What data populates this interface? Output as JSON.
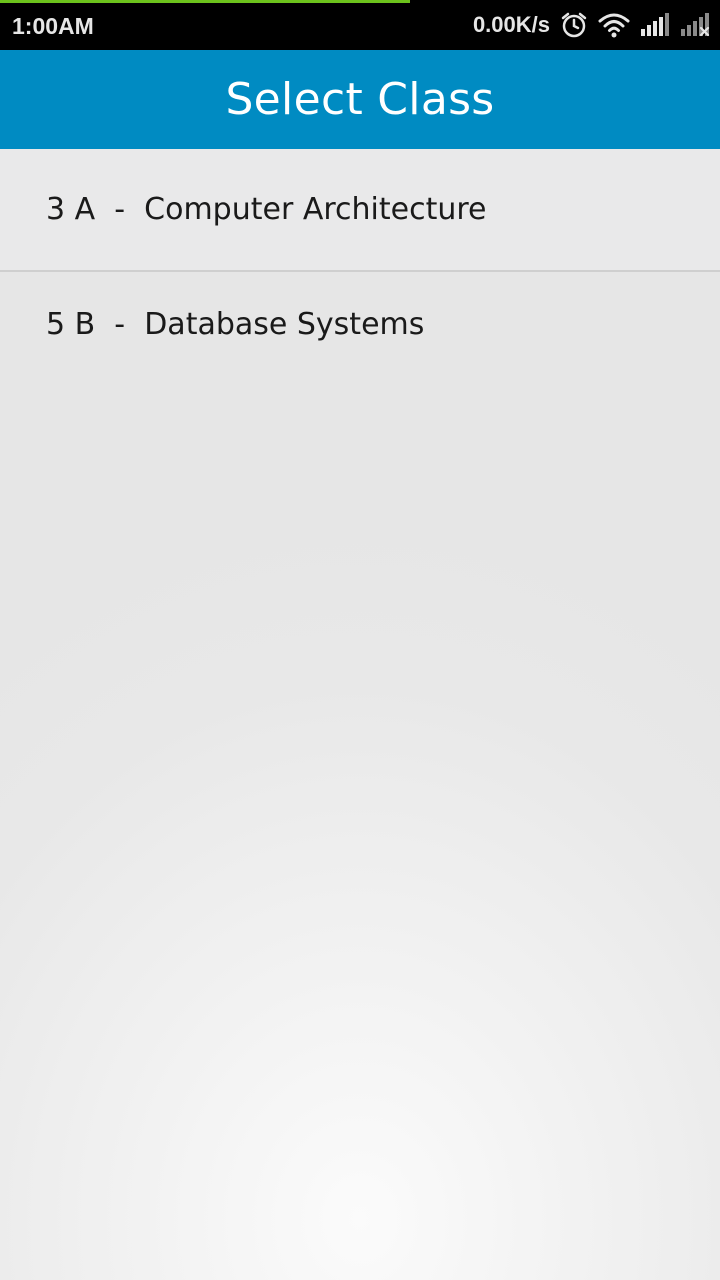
{
  "status_bar": {
    "time": "1:00AM",
    "net_speed": "0.00K/s",
    "download_progress": 0.57,
    "icons": [
      "alarm-icon",
      "wifi-icon",
      "signal-icon",
      "signal-no-service-icon"
    ],
    "colors": {
      "background": "#000000",
      "progress": "#6cc21c"
    }
  },
  "action_bar": {
    "title": "Select Class",
    "color": "#008bc2"
  },
  "class_list": {
    "items": [
      {
        "class": "3 A",
        "separator": "  -  ",
        "subject": "Computer Architecture"
      },
      {
        "class": "5 B",
        "separator": "  -  ",
        "subject": "Database Systems"
      }
    ]
  }
}
